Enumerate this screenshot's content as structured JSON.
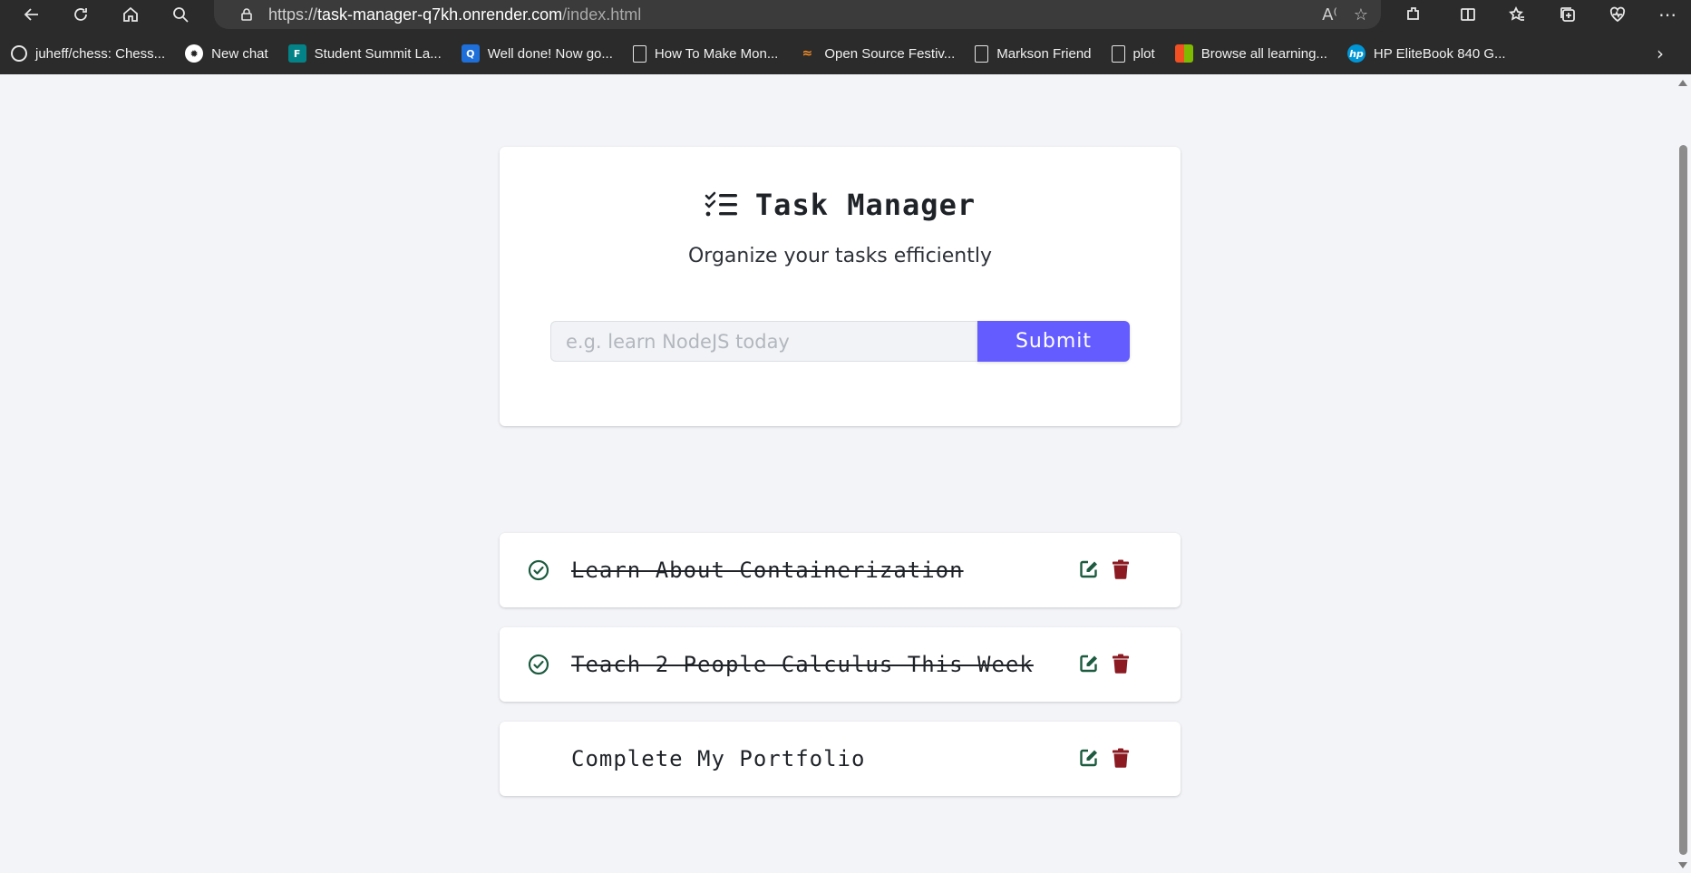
{
  "browser": {
    "url": {
      "scheme": "https://",
      "host": "task-manager-q7kh.onrender.com",
      "path": "/index.html"
    },
    "bookmarks": [
      {
        "label": "juheff/chess: Chess...",
        "icon": "github-icon",
        "color": "#2b2b2b"
      },
      {
        "label": "New chat",
        "icon": "openai-icon",
        "color": "#ffffff"
      },
      {
        "label": "Student Summit La...",
        "icon": "forms-icon",
        "color": "#038387"
      },
      {
        "label": "Well done! Now go...",
        "icon": "quiz-icon",
        "color": "#1e6fd9"
      },
      {
        "label": "How To Make Mon...",
        "icon": "page-icon",
        "color": "#2b2b2b"
      },
      {
        "label": "Open Source Festiv...",
        "icon": "osf-icon",
        "color": "#f08a24"
      },
      {
        "label": "Markson Friend",
        "icon": "page-icon",
        "color": "#2b2b2b"
      },
      {
        "label": "plot",
        "icon": "page-icon",
        "color": "#2b2b2b"
      },
      {
        "label": "Browse all learning...",
        "icon": "microsoft-icon",
        "color": "#f25022"
      },
      {
        "label": "HP EliteBook 840 G...",
        "icon": "hp-icon",
        "color": "#0096d6"
      }
    ]
  },
  "app": {
    "title": "Task Manager",
    "subtitle": "Organize your tasks efficiently",
    "input_placeholder": "e.g. learn NodeJS today",
    "input_value": "",
    "submit_label": "Submit",
    "accent_color": "#645cff",
    "done_color": "#1c5b3f",
    "delete_color": "#8b1a22"
  },
  "tasks": [
    {
      "name": "Learn About Containerization",
      "completed": true
    },
    {
      "name": "Teach 2 People Calculus This Week",
      "completed": true
    },
    {
      "name": "Complete My Portfolio",
      "completed": false
    }
  ]
}
